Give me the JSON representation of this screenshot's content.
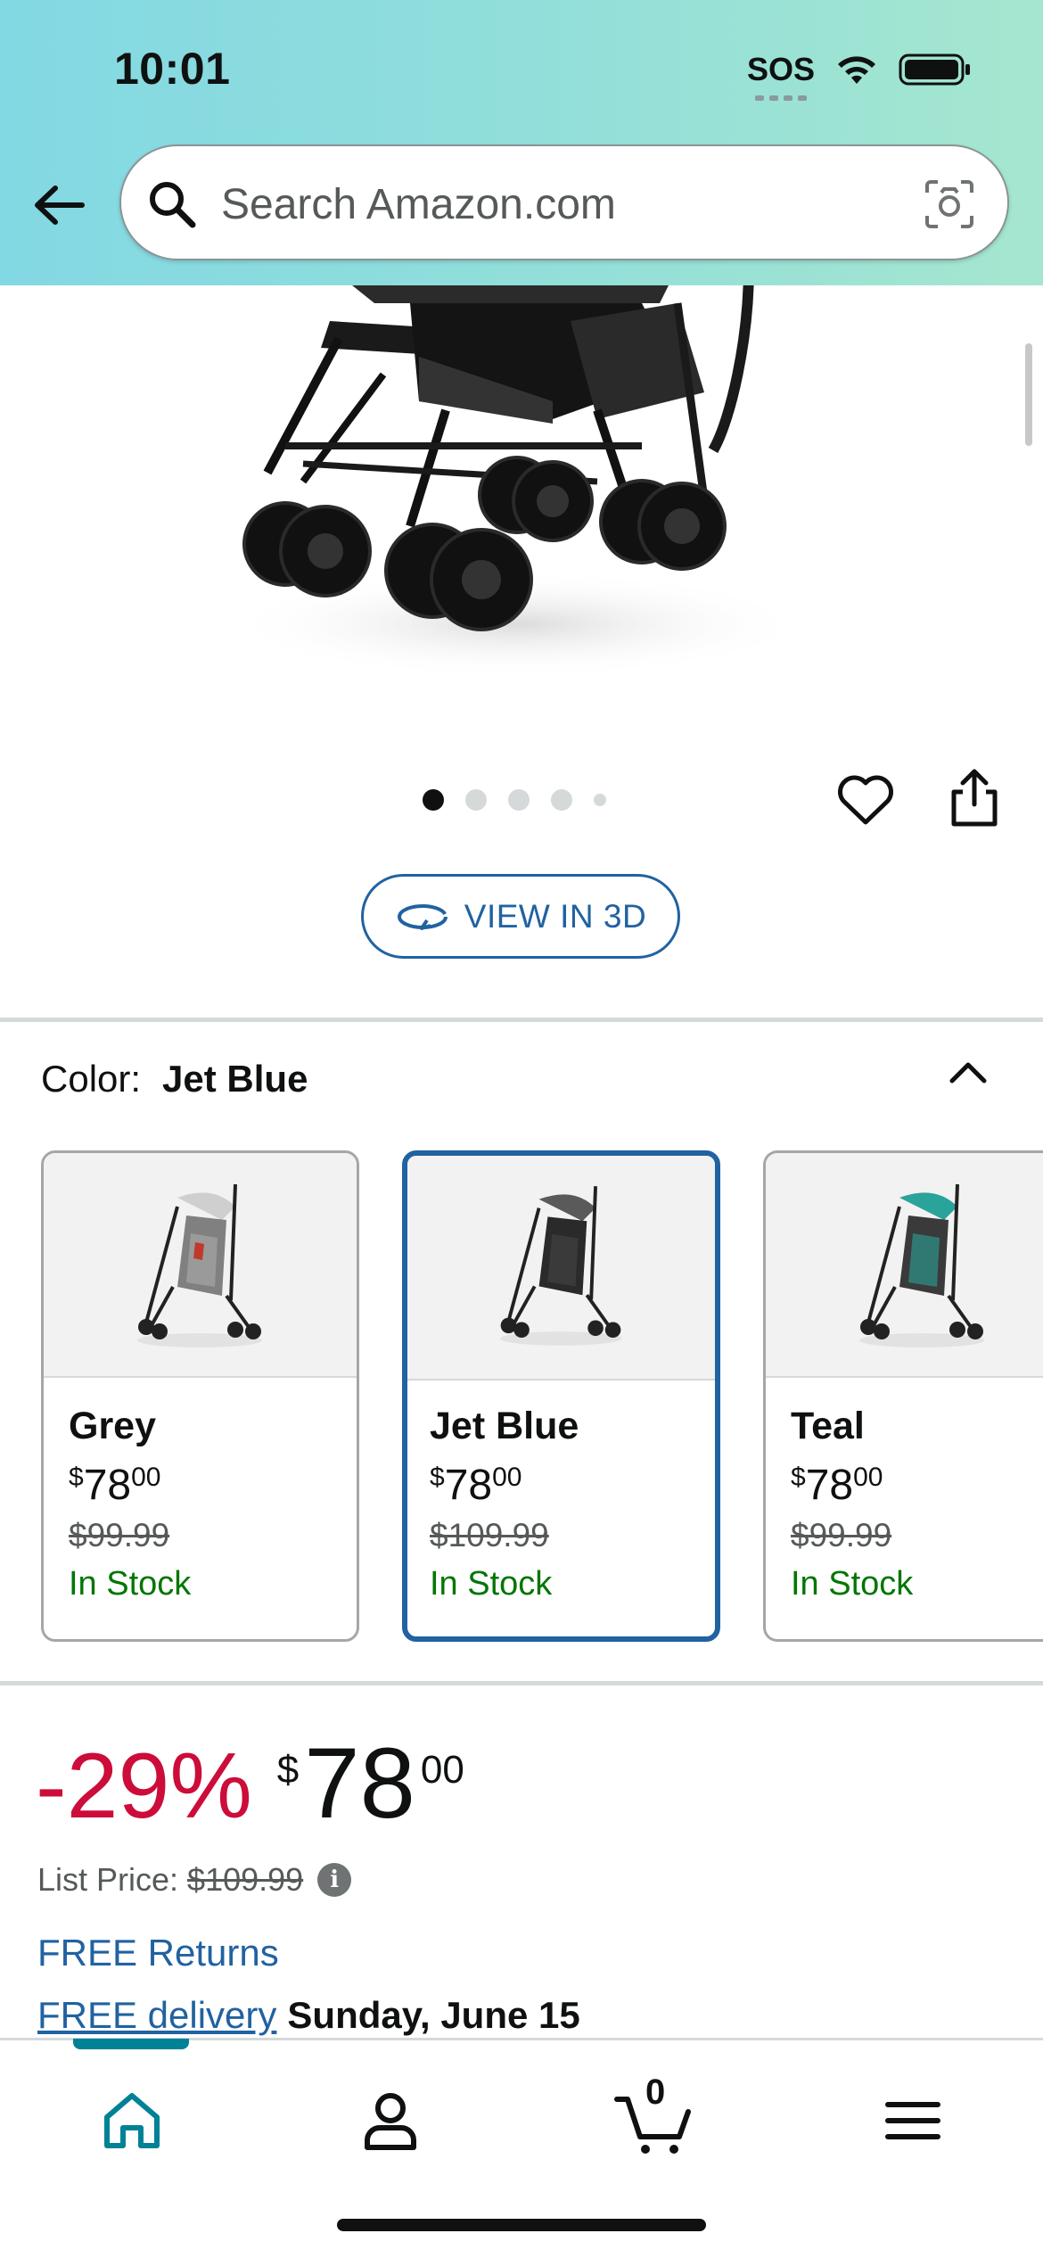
{
  "status_bar": {
    "time": "10:01",
    "sos": "SOS"
  },
  "search": {
    "placeholder": "Search Amazon.com"
  },
  "gallery": {
    "page_count": 5,
    "active_index": 0
  },
  "view3d": {
    "label": "VIEW IN 3D"
  },
  "color_selector": {
    "label": "Color:",
    "selected": "Jet Blue",
    "options": [
      {
        "name": "Grey",
        "currency": "$",
        "whole": "78",
        "fraction": "00",
        "list_price": "$99.99",
        "stock": "In Stock",
        "selected": false,
        "canopy_color": "#c9c9c9",
        "seat_color": "#7a7a7a"
      },
      {
        "name": "Jet Blue",
        "currency": "$",
        "whole": "78",
        "fraction": "00",
        "list_price": "$109.99",
        "stock": "In Stock",
        "selected": true,
        "canopy_color": "#5a5a5a",
        "seat_color": "#2a2a2a"
      },
      {
        "name": "Teal",
        "currency": "$",
        "whole": "78",
        "fraction": "00",
        "list_price": "$99.99",
        "stock": "In Stock",
        "selected": false,
        "canopy_color": "#2aa39a",
        "seat_color": "#3a3a3a"
      }
    ]
  },
  "pricing": {
    "discount": "-29%",
    "currency": "$",
    "whole": "78",
    "fraction": "00",
    "list_price_label": "List Price:",
    "list_price": "$109.99",
    "info_glyph": "i"
  },
  "shipping": {
    "free_returns": "FREE Returns",
    "free_delivery": "FREE delivery",
    "delivery_date": "Sunday, June 15"
  },
  "bottom_nav": {
    "items": [
      "home-icon",
      "account-icon",
      "cart-icon",
      "menu-icon"
    ],
    "active": "home-icon",
    "cart_count": "0"
  },
  "colors": {
    "accent": "#2162a1",
    "deal": "#cc0c39",
    "stock": "#007600",
    "nav_active": "#008296"
  }
}
